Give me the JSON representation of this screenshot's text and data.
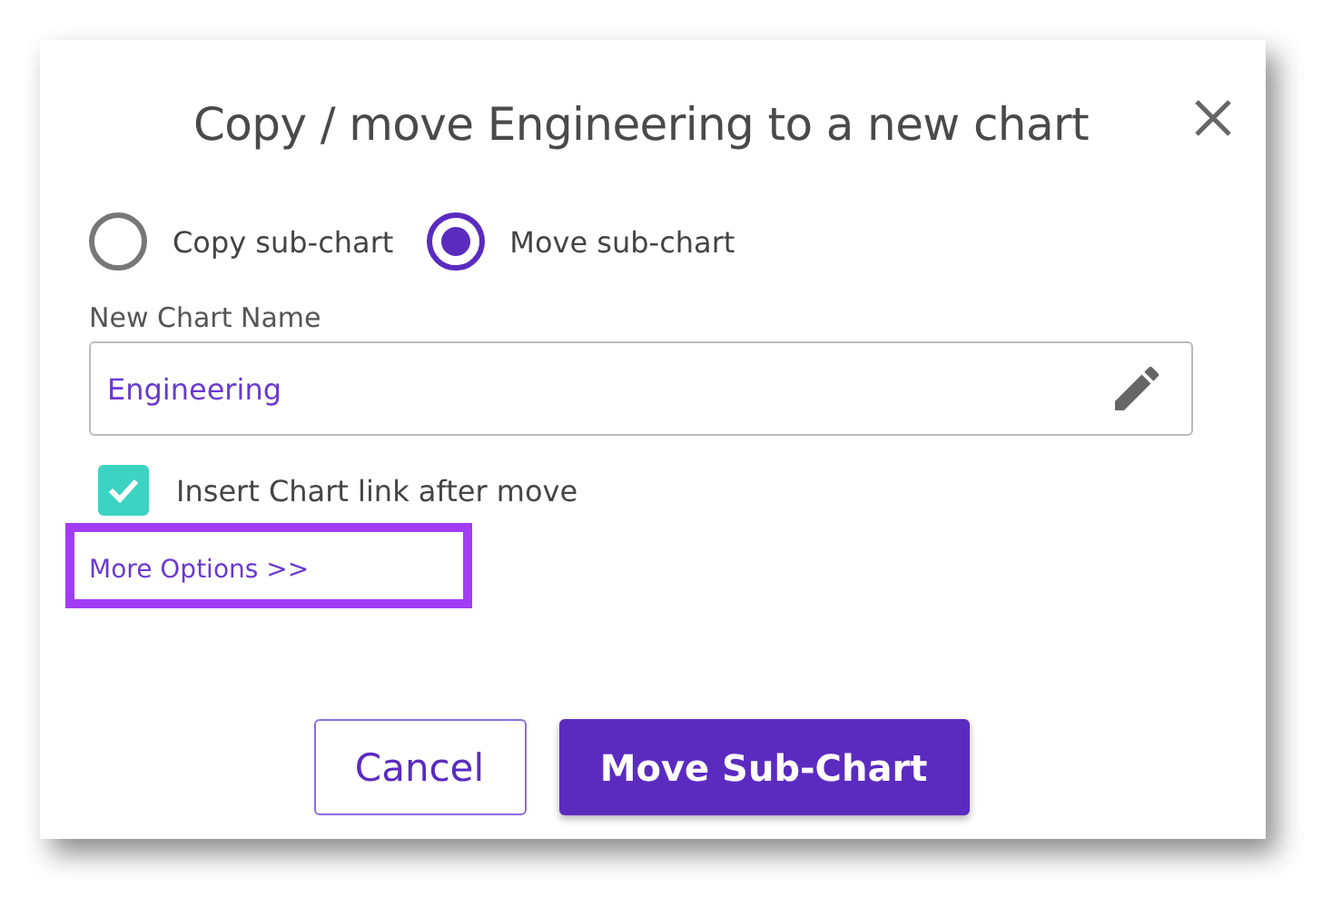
{
  "dialog": {
    "title": "Copy / move Engineering to a new chart",
    "options": [
      {
        "label": "Copy sub-chart",
        "selected": false
      },
      {
        "label": "Move sub-chart",
        "selected": true
      }
    ],
    "name_field": {
      "label": "New Chart Name",
      "value": "Engineering"
    },
    "checkbox": {
      "label": "Insert Chart link after move",
      "checked": true
    },
    "more_link": {
      "text": "More Options >>",
      "highlighted": true
    },
    "buttons": [
      {
        "label": "Cancel",
        "kind": "secondary"
      },
      {
        "label": "Move Sub-Chart",
        "kind": "primary"
      }
    ]
  }
}
